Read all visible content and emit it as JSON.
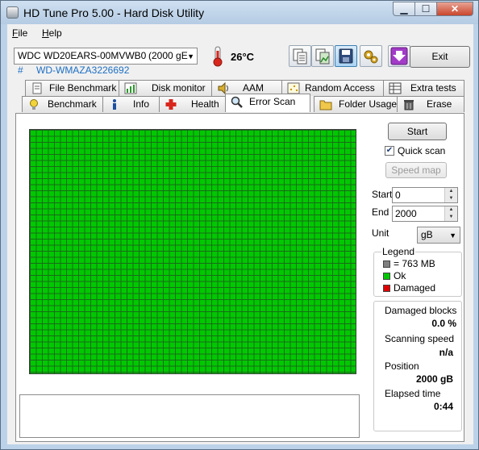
{
  "window": {
    "title": "HD Tune Pro 5.00 - Hard Disk Utility",
    "min_glyph": "▁",
    "max_glyph": "☐",
    "close_glyph": "✕"
  },
  "menu": {
    "file": "File",
    "help": "Help"
  },
  "toolbar": {
    "drive_name": "WDC WD20EARS-00MVWB0",
    "drive_capacity": "(2000 gE",
    "temperature": "26°C",
    "exit_label": "Exit",
    "serial_hash": "#",
    "serial": "WD-WMAZA3226692",
    "icons": [
      "copy-text-icon",
      "copy-screenshot-icon",
      "save-icon",
      "options-icon",
      "download-icon"
    ]
  },
  "tabs": {
    "row1": [
      "File Benchmark",
      "Disk monitor",
      "AAM",
      "Random Access",
      "Extra tests"
    ],
    "row2": [
      "Benchmark",
      "Info",
      "Health",
      "Error Scan",
      "Folder Usage",
      "Erase"
    ],
    "active": "Error Scan"
  },
  "scan": {
    "start_button": "Start",
    "quick_scan_label": "Quick scan",
    "quick_scan_checked": true,
    "speed_map_button": "Speed map",
    "start_label": "Start",
    "start_value": "0",
    "end_label": "End",
    "end_value": "2000",
    "unit_label": "Unit",
    "unit_value": "gB",
    "block_status": "ok"
  },
  "legend": {
    "title": "Legend",
    "block_size": "= 763 MB",
    "ok": "Ok",
    "damaged": "Damaged",
    "colors": {
      "block": "#808080",
      "ok": "#00c800",
      "damaged": "#e00000"
    }
  },
  "stats": {
    "damaged_blocks_label": "Damaged blocks",
    "damaged_blocks_value": "0.0 %",
    "scanning_speed_label": "Scanning speed",
    "scanning_speed_value": "n/a",
    "position_label": "Position",
    "position_value": "2000 gB",
    "elapsed_label": "Elapsed time",
    "elapsed_value": "0:44"
  }
}
